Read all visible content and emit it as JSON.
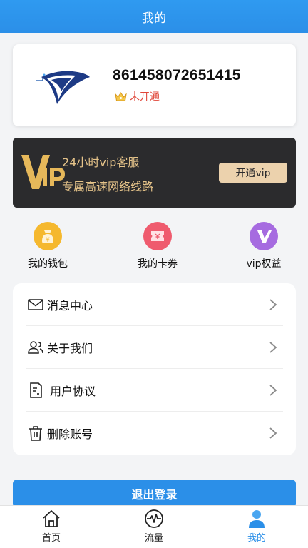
{
  "header": {
    "title": "我的"
  },
  "profile": {
    "user_id": "861458072651415",
    "vip_status": "未开通"
  },
  "vip_banner": {
    "line1": "24小时vip客服",
    "line2": "专属高速网络线路",
    "button_label": "开通vip",
    "logo_text": "VIP"
  },
  "quick_actions": [
    {
      "label": "我的钱包",
      "icon": "wallet-icon",
      "color": "#f5b82e"
    },
    {
      "label": "我的卡券",
      "icon": "coupon-icon",
      "color": "#ef5b6e"
    },
    {
      "label": "vip权益",
      "icon": "vip-icon",
      "color": "#a66be0"
    }
  ],
  "menu": [
    {
      "label": "消息中心",
      "icon": "mail-icon"
    },
    {
      "label": "关于我们",
      "icon": "users-icon"
    },
    {
      "label": "用户协议",
      "icon": "document-icon"
    },
    {
      "label": "删除账号",
      "icon": "trash-icon"
    }
  ],
  "logout_label": "退出登录",
  "bottom_nav": [
    {
      "label": "首页",
      "icon": "home-icon",
      "active": false
    },
    {
      "label": "流量",
      "icon": "pulse-icon",
      "active": false
    },
    {
      "label": "我的",
      "icon": "person-icon",
      "active": true
    }
  ],
  "colors": {
    "primary": "#2b8fe8",
    "vip_gold": "#e6c48a",
    "vip_bg": "#2b2b2d",
    "status_red": "#e0473a"
  }
}
